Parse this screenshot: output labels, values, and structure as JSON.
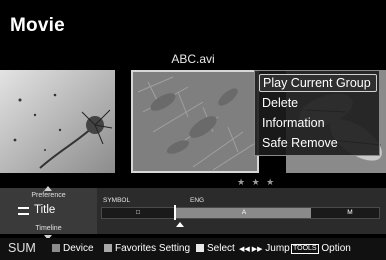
{
  "header": {
    "title": "Movie",
    "file_name": "ABC.avi"
  },
  "rating": {
    "stars": "★ ★ ★"
  },
  "context_menu": {
    "items": [
      {
        "label": "Play Current Group",
        "selected": true
      },
      {
        "label": "Delete",
        "selected": false
      },
      {
        "label": "Information",
        "selected": false
      },
      {
        "label": "Safe Remove",
        "selected": false
      }
    ]
  },
  "sort_panel": {
    "above_label": "Preference",
    "current": "Title",
    "below_label": "Timeline",
    "categories": {
      "symbol": "SYMBOL",
      "eng": "ENG"
    },
    "bar_marks": {
      "symbol_mark": "□",
      "a_mark": "A",
      "m_mark": "M"
    }
  },
  "bottom_bar": {
    "sum_label": "SUM",
    "device_label": "Device",
    "favorites_label": "Favorites Setting",
    "select_label": "Select",
    "jump_icons": "◀◀ ▶▶",
    "jump_label": "Jump",
    "tools_key": "TOOLS",
    "option_label": "Option"
  },
  "colors": {
    "background": "#000000",
    "panel": "#2b2b2b",
    "highlight": "#8a8a8a"
  }
}
